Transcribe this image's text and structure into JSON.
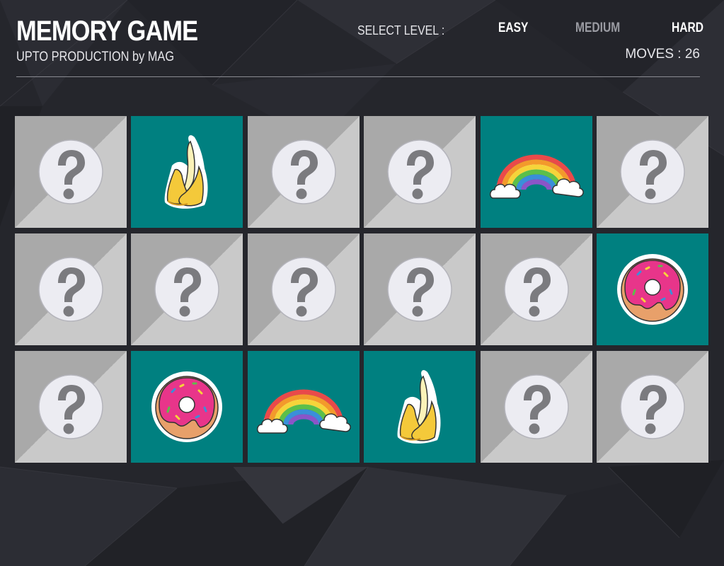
{
  "app": {
    "title": "MEMORY GAME",
    "subtitle": "UPTO PRODUCTION by MAG"
  },
  "level": {
    "label": "SELECT LEVEL :",
    "options": [
      "EASY",
      "MEDIUM",
      "HARD"
    ],
    "selected": "MEDIUM"
  },
  "moves": {
    "text": "MOVES : 26",
    "count": 26
  },
  "colors": {
    "background": "#24252b",
    "card_revealed": "#008080",
    "card_back_dark": "#a9a9a9",
    "card_back_light": "#c9c9c9",
    "level_inactive": "#9a9ba2"
  },
  "board": {
    "rows": 3,
    "columns": 6,
    "cards": [
      {
        "state": "hidden",
        "icon": "question-mark-icon"
      },
      {
        "state": "revealed",
        "icon": "banana-icon"
      },
      {
        "state": "hidden",
        "icon": "question-mark-icon"
      },
      {
        "state": "hidden",
        "icon": "question-mark-icon"
      },
      {
        "state": "revealed",
        "icon": "rainbow-icon"
      },
      {
        "state": "hidden",
        "icon": "question-mark-icon"
      },
      {
        "state": "hidden",
        "icon": "question-mark-icon"
      },
      {
        "state": "hidden",
        "icon": "question-mark-icon"
      },
      {
        "state": "hidden",
        "icon": "question-mark-icon"
      },
      {
        "state": "hidden",
        "icon": "question-mark-icon"
      },
      {
        "state": "hidden",
        "icon": "question-mark-icon"
      },
      {
        "state": "revealed",
        "icon": "donut-icon"
      },
      {
        "state": "hidden",
        "icon": "question-mark-icon"
      },
      {
        "state": "revealed",
        "icon": "donut-icon"
      },
      {
        "state": "revealed",
        "icon": "rainbow-icon"
      },
      {
        "state": "revealed",
        "icon": "banana-icon"
      },
      {
        "state": "hidden",
        "icon": "question-mark-icon"
      },
      {
        "state": "hidden",
        "icon": "question-mark-icon"
      }
    ]
  }
}
